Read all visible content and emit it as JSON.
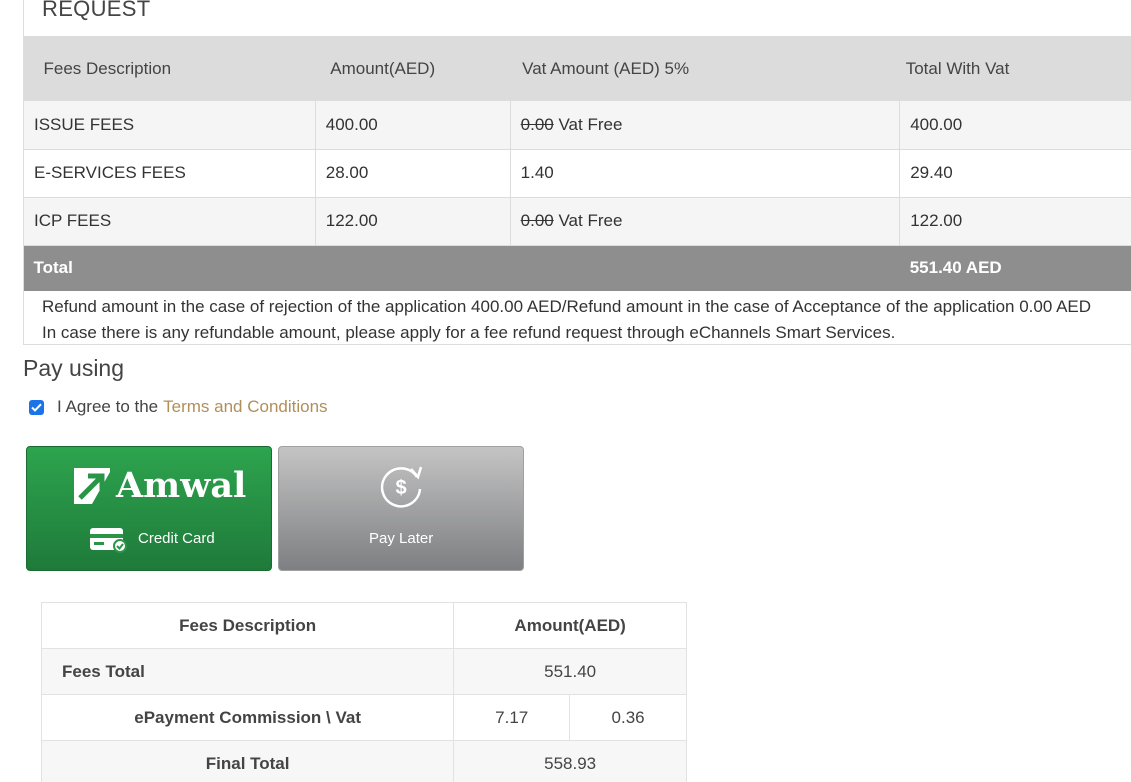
{
  "request": {
    "title": "REQUEST",
    "headers": [
      "Fees Description",
      "Amount(AED)",
      "Vat Amount (AED) 5%",
      "Total With Vat"
    ],
    "rows": [
      {
        "desc": "ISSUE FEES",
        "amount": "400.00",
        "vat_struck": "0.00",
        "vat_note": "Vat Free",
        "total": "400.00"
      },
      {
        "desc": "E-SERVICES FEES",
        "amount": "28.00",
        "vat_struck": "",
        "vat_note": "1.40",
        "total": "29.40"
      },
      {
        "desc": "ICP FEES",
        "amount": "122.00",
        "vat_struck": "0.00",
        "vat_note": "Vat Free",
        "total": "122.00"
      }
    ],
    "total_label": "Total",
    "total_value": "551.40 AED",
    "refund_line1": "Refund amount in the case of rejection of the application 400.00 AED/Refund amount in the case of Acceptance of the application 0.00 AED",
    "refund_line2": "In case there is any refundable amount, please apply for a fee refund request through eChannels Smart Services."
  },
  "payment": {
    "title": "Pay using",
    "agree_text": "I Agree to the",
    "terms_link": "Terms and Conditions",
    "agree_checked": true,
    "amwal_brand": "Amwal",
    "credit_card_label": "Credit Card",
    "pay_later_label": "Pay Later",
    "amwal_color": "#2da44e"
  },
  "summary": {
    "header_desc": "Fees Description",
    "header_amount": "Amount(AED)",
    "fees_total_label": "Fees Total",
    "fees_total_value": "551.40",
    "commission_label": "ePayment Commission \\ Vat",
    "commission_value": "7.17",
    "commission_vat": "0.36",
    "final_total_label": "Final Total",
    "final_total_value": "558.93"
  }
}
